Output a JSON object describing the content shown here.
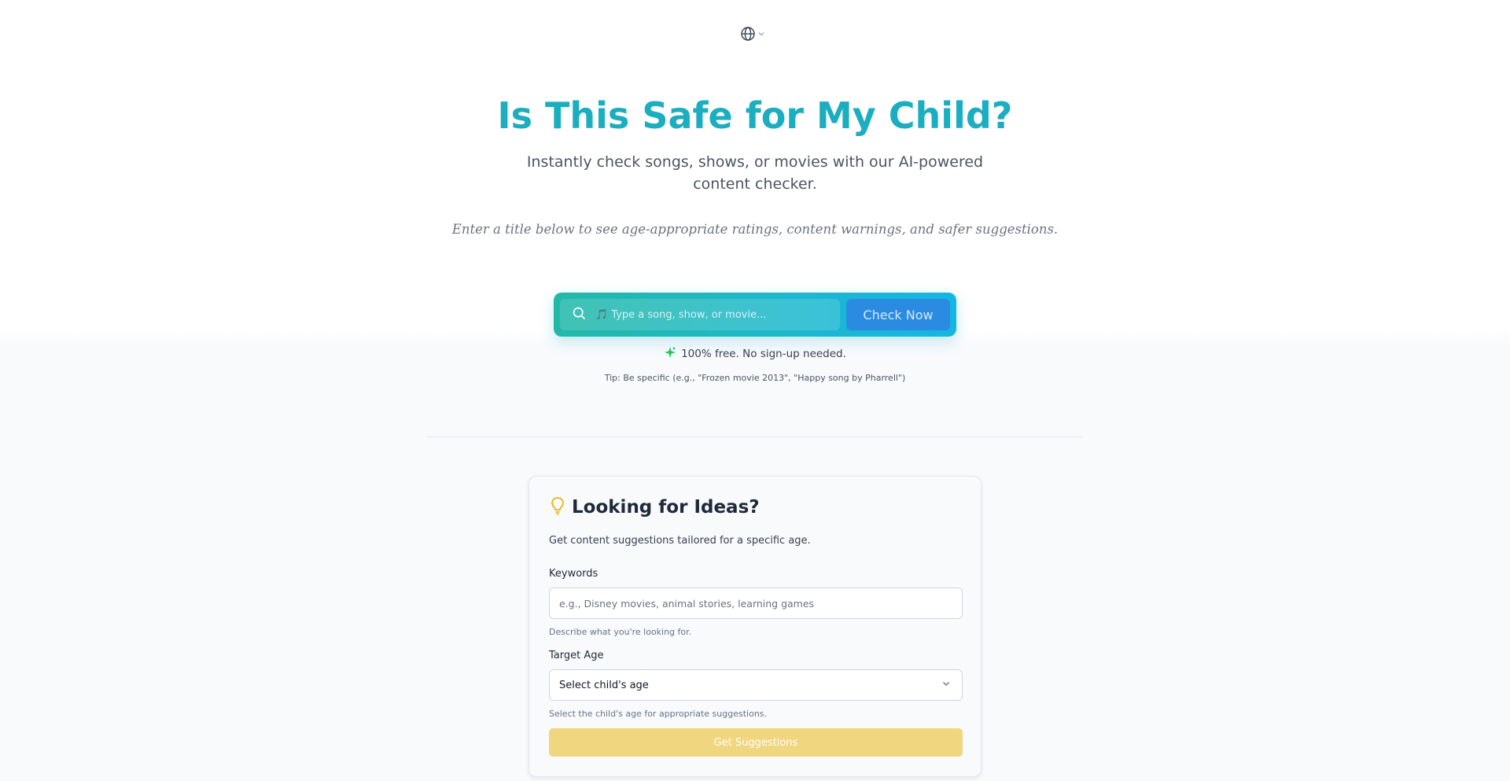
{
  "header": {
    "language_icon": "globe-icon",
    "language_chevron_icon": "chevron-down-icon"
  },
  "hero": {
    "title": "Is This Safe for My Child?",
    "subtitle": "Instantly check songs, shows, or movies with our AI-powered content checker.",
    "note": "Enter a title below to see age-appropriate ratings, content warnings, and safer suggestions."
  },
  "search": {
    "placeholder": "🎵 Type a song, show, or movie...",
    "value": "",
    "button_label": "Check Now",
    "icon": "search-icon"
  },
  "free_note": {
    "icon": "sparkle-icon",
    "text": "100% free. No sign-up needed."
  },
  "tip": "Tip: Be specific (e.g., \"Frozen movie 2013\", \"Happy song by Pharrell\")",
  "ideas": {
    "icon": "lightbulb-icon",
    "title": "Looking for Ideas?",
    "description": "Get content suggestions tailored for a specific age.",
    "keywords_label": "Keywords",
    "keywords_placeholder": "e.g., Disney movies, animal stories, learning games",
    "keywords_help": "Describe what you're looking for.",
    "age_label": "Target Age",
    "age_selected": "Select child's age",
    "age_help": "Select the child's age for appropriate suggestions.",
    "button_label": "Get Suggestions"
  },
  "colors": {
    "title": "#1aaec0",
    "search_gradient_start": "#22b8a8",
    "search_gradient_end": "#13b6e4",
    "check_button": "#2b8be0",
    "suggest_button": "#f0d67e",
    "lightbulb": "#eab308",
    "sparkle": "#22c55e"
  }
}
